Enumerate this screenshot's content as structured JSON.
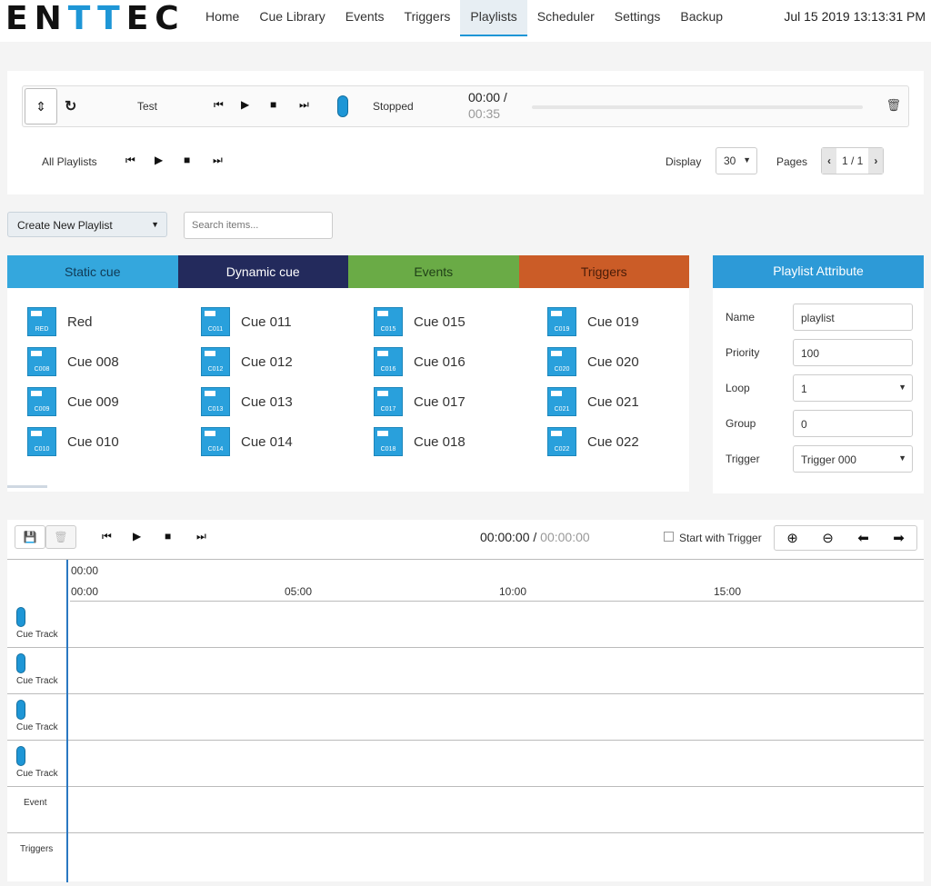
{
  "brand": {
    "prefix": "EN",
    "highlight": "TT",
    "suffix": "EC"
  },
  "nav": {
    "items": [
      "Home",
      "Cue Library",
      "Events",
      "Triggers",
      "Playlists",
      "Scheduler",
      "Settings",
      "Backup"
    ],
    "active": "Playlists"
  },
  "datetime": "Jul 15 2019 13:13:31 PM",
  "player": {
    "playlist_name": "Test",
    "status": "Stopped",
    "current_time": "00:00 /",
    "total_time": "00:35",
    "progress": 0
  },
  "all_playlists": {
    "label": "All Playlists",
    "display_label": "Display",
    "display_value": "30",
    "pages_label": "Pages",
    "pages_value": "1 / 1"
  },
  "playlist_tools": {
    "create_label": "Create New Playlist",
    "search_placeholder": "Search items..."
  },
  "cue_tabs": [
    "Static cue",
    "Dynamic cue",
    "Events",
    "Triggers"
  ],
  "cues": [
    {
      "code": "RED",
      "name": "Red"
    },
    {
      "code": "C008",
      "name": "Cue 008"
    },
    {
      "code": "C009",
      "name": "Cue 009"
    },
    {
      "code": "C010",
      "name": "Cue 010"
    },
    {
      "code": "C011",
      "name": "Cue 011"
    },
    {
      "code": "C012",
      "name": "Cue 012"
    },
    {
      "code": "C013",
      "name": "Cue 013"
    },
    {
      "code": "C014",
      "name": "Cue 014"
    },
    {
      "code": "C015",
      "name": "Cue 015"
    },
    {
      "code": "C016",
      "name": "Cue 016"
    },
    {
      "code": "C017",
      "name": "Cue 017"
    },
    {
      "code": "C018",
      "name": "Cue 018"
    },
    {
      "code": "C019",
      "name": "Cue 019"
    },
    {
      "code": "C020",
      "name": "Cue 020"
    },
    {
      "code": "C021",
      "name": "Cue 021"
    },
    {
      "code": "C022",
      "name": "Cue 022"
    }
  ],
  "attributes": {
    "title": "Playlist Attribute",
    "fields": [
      {
        "label": "Name",
        "value": "playlist"
      },
      {
        "label": "Priority",
        "value": "100"
      },
      {
        "label": "Loop",
        "value": "1"
      },
      {
        "label": "Group",
        "value": "0"
      },
      {
        "label": "Trigger",
        "value": "Trigger 000"
      }
    ]
  },
  "timeline": {
    "current_time": "00:00:00",
    "separator": " / ",
    "total_time": "00:00:00",
    "start_trigger_label": "Start with Trigger",
    "ruler_top": "00:00",
    "ruler_ticks": [
      "00:00",
      "05:00",
      "10:00",
      "15:00"
    ],
    "tracks": [
      "Cue Track",
      "Cue Track",
      "Cue Track",
      "Cue Track"
    ],
    "event_label": "Event",
    "triggers_label": "Triggers"
  },
  "colors": {
    "accent": "#1e96d6",
    "static_tab": "#34a7dd",
    "dynamic_tab": "#232a5c",
    "events_tab": "#6aab46",
    "triggers_tab": "#cb5c27"
  },
  "icons": {
    "reorder": "updown-icon",
    "refresh": "refresh-icon",
    "delete": "trash-icon",
    "save": "save-icon",
    "zoom_in": "zoom-in-icon",
    "zoom_out": "zoom-out-icon"
  }
}
